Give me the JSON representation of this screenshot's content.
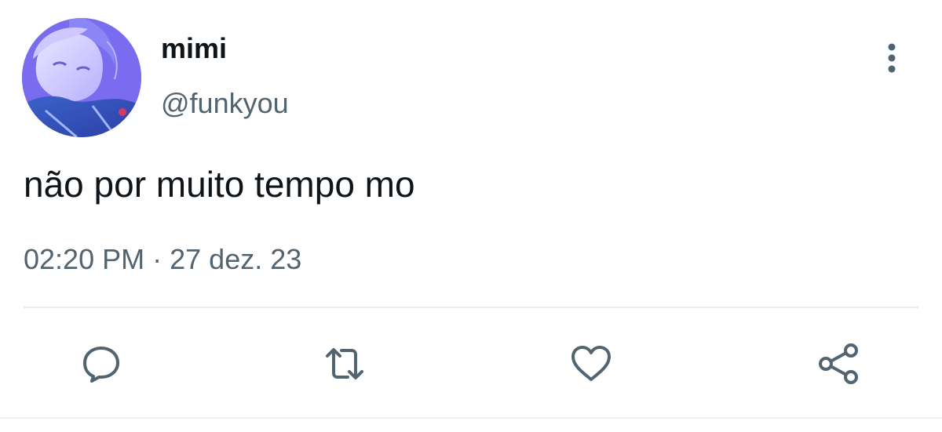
{
  "user": {
    "display_name": "mimi",
    "handle": "@funkyou"
  },
  "tweet": {
    "text": "não por muito tempo mo",
    "time": "02:20 PM",
    "separator": "·",
    "date": "27 dez. 23"
  },
  "icons": {
    "more": "more-vertical-icon",
    "reply": "reply-icon",
    "retweet": "retweet-icon",
    "like": "heart-icon",
    "share": "share-icon"
  },
  "colors": {
    "text_primary": "#0f1419",
    "text_secondary": "#536471",
    "icon": "#536471",
    "divider": "#e6ecf0",
    "background": "#ffffff"
  }
}
